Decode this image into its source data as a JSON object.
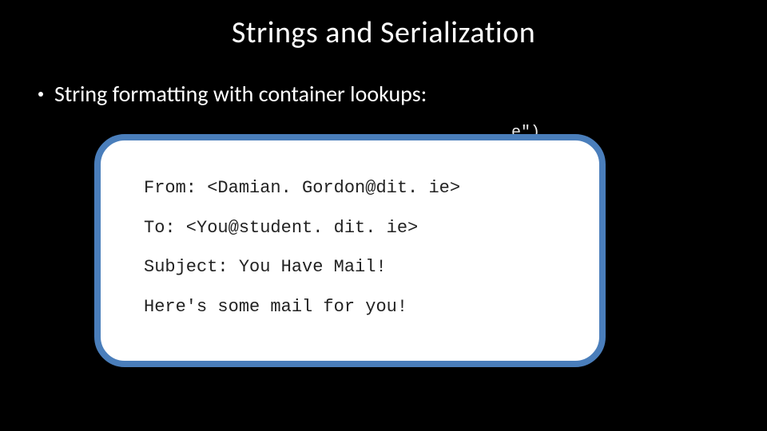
{
  "slide": {
    "title": "Strings and Serialization",
    "bullet_text": "String formatting with container lookups:",
    "background_code_fragment": "e\")",
    "email": {
      "from_line": "From: <Damian. Gordon@dit. ie>",
      "to_line": "To: <You@student. dit. ie>",
      "subject_line": "Subject: You Have Mail!",
      "body_line": "Here's some mail for you!"
    }
  }
}
